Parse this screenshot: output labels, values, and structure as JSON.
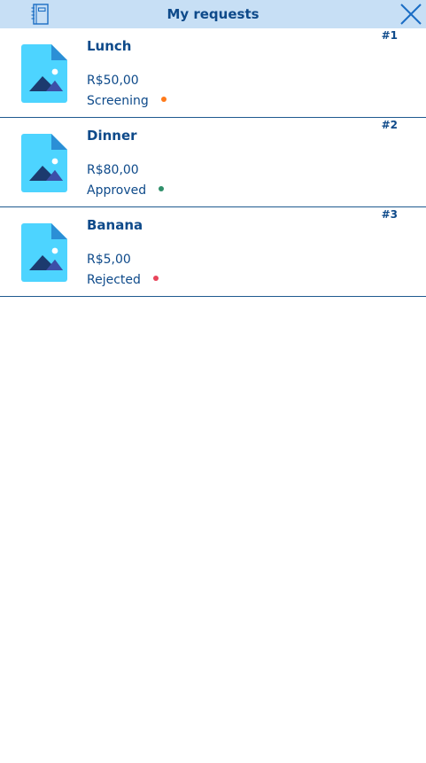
{
  "header": {
    "title": "My requests",
    "left_icon": "notebook-icon",
    "right_icon": "close-icon"
  },
  "colors": {
    "header_bg": "#c7dff5",
    "text_primary": "#0e4a8a",
    "divider": "#1f5a8f",
    "icon_file": "#4dd4ff",
    "icon_file_corner": "#2b8fd6",
    "icon_mountain": "#1c3a6e"
  },
  "requests": [
    {
      "number": "#1",
      "name": "Lunch",
      "amount": "R$50,00",
      "status": "Screening",
      "status_color": "#ff7a1a",
      "icon": "image-file-icon"
    },
    {
      "number": "#2",
      "name": "Dinner",
      "amount": "R$80,00",
      "status": "Approved",
      "status_color": "#2f8f6a",
      "icon": "image-file-icon"
    },
    {
      "number": "#3",
      "name": "Banana",
      "amount": "R$5,00",
      "status": "Rejected",
      "status_color": "#e8445a",
      "icon": "image-file-icon"
    }
  ]
}
